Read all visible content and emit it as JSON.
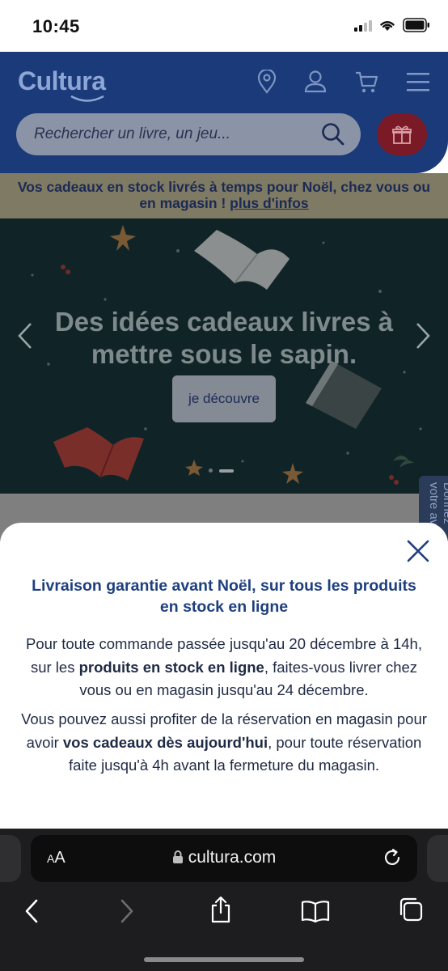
{
  "status_bar": {
    "time": "10:45"
  },
  "header": {
    "logo": "Cultura",
    "search_placeholder": "Rechercher un livre, un jeu..."
  },
  "promo_banner": {
    "text": "Vos cadeaux en stock livrés à temps pour Noël, chez vous ou en magasin ! ",
    "link": "plus d'infos"
  },
  "hero": {
    "title": "Des idées cadeaux livres à mettre sous le sapin.",
    "cta": "je découvre",
    "slides_total": 2,
    "active_slide": 2
  },
  "feedback_tab": {
    "label": "Donnez votre avis"
  },
  "modal": {
    "title": "Livraison garantie avant Noël, sur tous les produits en stock en ligne",
    "p1_before": "Pour toute commande passée jusqu'au 20 décembre à 14h, sur les ",
    "p1_bold": "produits en stock en ligne",
    "p1_after": ", faites-vous livrer chez vous ou en magasin jusqu'au 24 décembre.",
    "p2_before": "Vous pouvez aussi profiter de la réservation en magasin pour avoir ",
    "p2_bold": "vos cadeaux dès aujourd'hui",
    "p2_after": ", pour toute réservation faite jusqu'à 4h avant la fermeture du magasin."
  },
  "browser": {
    "url": "cultura.com",
    "text_size_label_small": "A",
    "text_size_label_large": "A"
  },
  "colors": {
    "brand_blue": "#1e3f7f",
    "modal_text": "#1f2a44"
  }
}
